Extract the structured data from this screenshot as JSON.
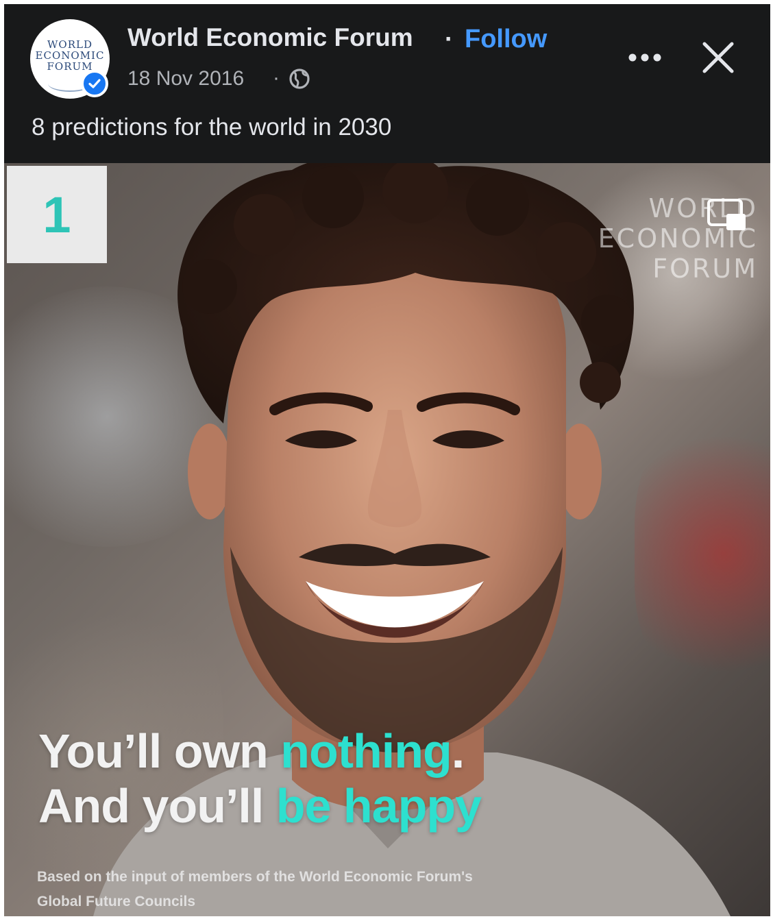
{
  "post": {
    "page_name": "World Economic Forum",
    "separator": "·",
    "follow_label": "Follow",
    "date": "18 Nov 2016",
    "date_separator": "·",
    "audience_icon": "globe-icon",
    "verified_icon": "verified-badge-icon",
    "more_icon": "more-options-icon",
    "close_icon": "close-icon",
    "caption": "8 predictions for the world in 2030",
    "avatar_logo": [
      "WORLD",
      "ECONOMIC",
      "FORUM"
    ]
  },
  "image": {
    "slide_number": "1",
    "watermark": [
      "WORLD",
      "ECONOMIC",
      "FORUM"
    ],
    "pip_icon": "picture-in-picture-icon",
    "headline_line1_prefix": "You’ll own ",
    "headline_line1_accent": "nothing",
    "headline_line1_suffix": ".",
    "headline_line2_prefix": "And you’ll ",
    "headline_line2_accent": "be happy",
    "footnote_line1": "Based on the input of members of the World Economic Forum's",
    "footnote_line2": "Global Future Councils"
  },
  "colors": {
    "background": "#18191a",
    "text_primary": "#e4e6eb",
    "text_secondary": "#b0b3b8",
    "follow": "#4599ff",
    "verified": "#1877f2",
    "accent_teal": "#2de0cf"
  }
}
